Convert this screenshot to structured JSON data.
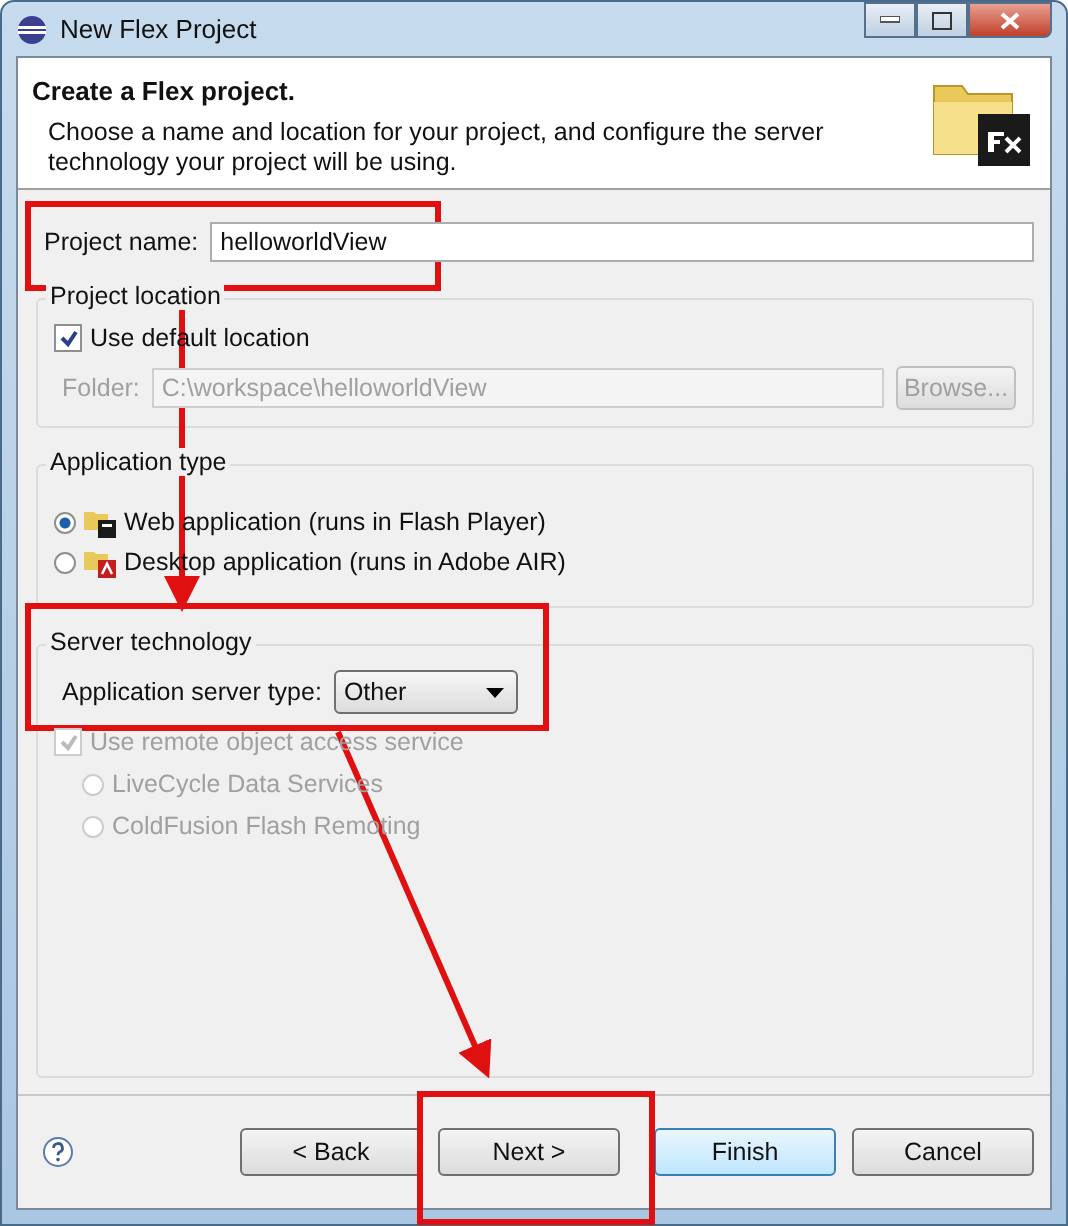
{
  "window": {
    "title": "New Flex Project"
  },
  "header": {
    "title": "Create a Flex project.",
    "description": "Choose a name and location for your project, and configure the server technology your project will be using."
  },
  "project_name": {
    "label": "Project name:",
    "value": "helloworldView"
  },
  "project_location": {
    "title": "Project location",
    "use_default": {
      "label": "Use default location",
      "checked": true
    },
    "folder": {
      "label": "Folder:",
      "value": "C:\\workspace\\helloworldView",
      "disabled": true
    },
    "browse": {
      "label": "Browse...",
      "disabled": true
    }
  },
  "application_type": {
    "title": "Application type",
    "options": [
      {
        "label": "Web application (runs in Flash Player)",
        "kind": "web",
        "selected": true
      },
      {
        "label": "Desktop application (runs in Adobe AIR)",
        "kind": "desktop",
        "selected": false
      }
    ]
  },
  "server_technology": {
    "title": "Server technology",
    "server_type": {
      "label": "Application server type:",
      "value": "Other"
    },
    "remote_object": {
      "label": "Use remote object access service",
      "checked": true,
      "disabled": true
    },
    "options": [
      {
        "label": "LiveCycle Data Services",
        "selected": false,
        "disabled": true
      },
      {
        "label": "ColdFusion Flash Remoting",
        "selected": false,
        "disabled": true
      }
    ]
  },
  "buttons": [
    {
      "label": "< Back",
      "default": false
    },
    {
      "label": "Next >",
      "default": false
    },
    {
      "label": "Finish",
      "default": true
    },
    {
      "label": "Cancel",
      "default": false
    }
  ]
}
